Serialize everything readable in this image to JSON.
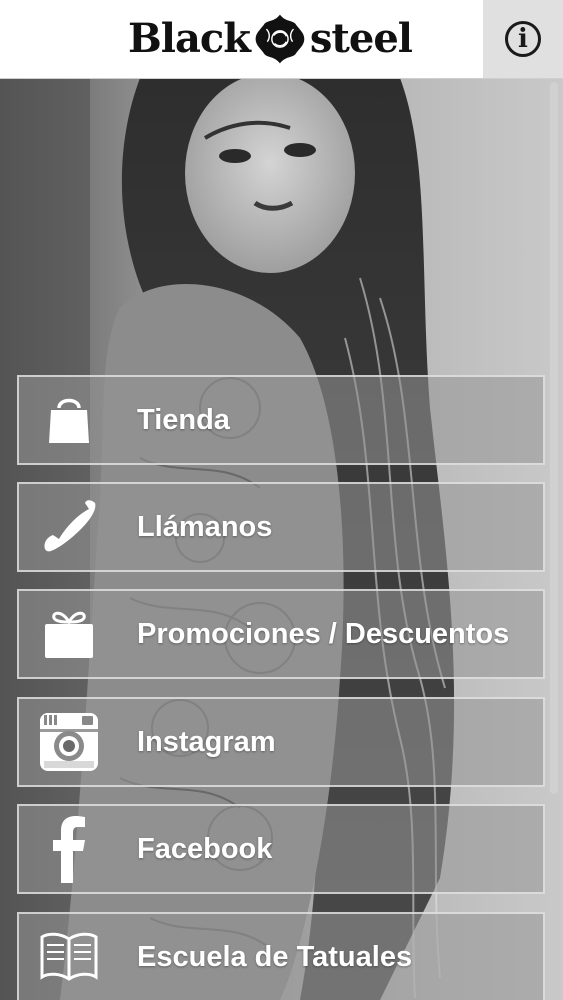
{
  "header": {
    "logo_left": "Black",
    "logo_right": "steel",
    "info_icon": "info-circle-icon",
    "info_glyph": "i"
  },
  "menu": {
    "items": [
      {
        "label": "Tienda",
        "icon": "shopping-bag-icon"
      },
      {
        "label": "Llámanos",
        "icon": "phone-icon"
      },
      {
        "label": "Promociones / Descuentos",
        "icon": "gift-icon"
      },
      {
        "label": "Instagram",
        "icon": "instagram-icon"
      },
      {
        "label": "Facebook",
        "icon": "facebook-icon"
      },
      {
        "label": "Escuela de Tatuales",
        "icon": "book-icon"
      }
    ]
  },
  "colors": {
    "header_bg": "#ffffff",
    "info_bg": "#e0e0e0",
    "menu_text": "#ffffff",
    "menu_bg": "rgba(150,150,150,0.55)"
  }
}
